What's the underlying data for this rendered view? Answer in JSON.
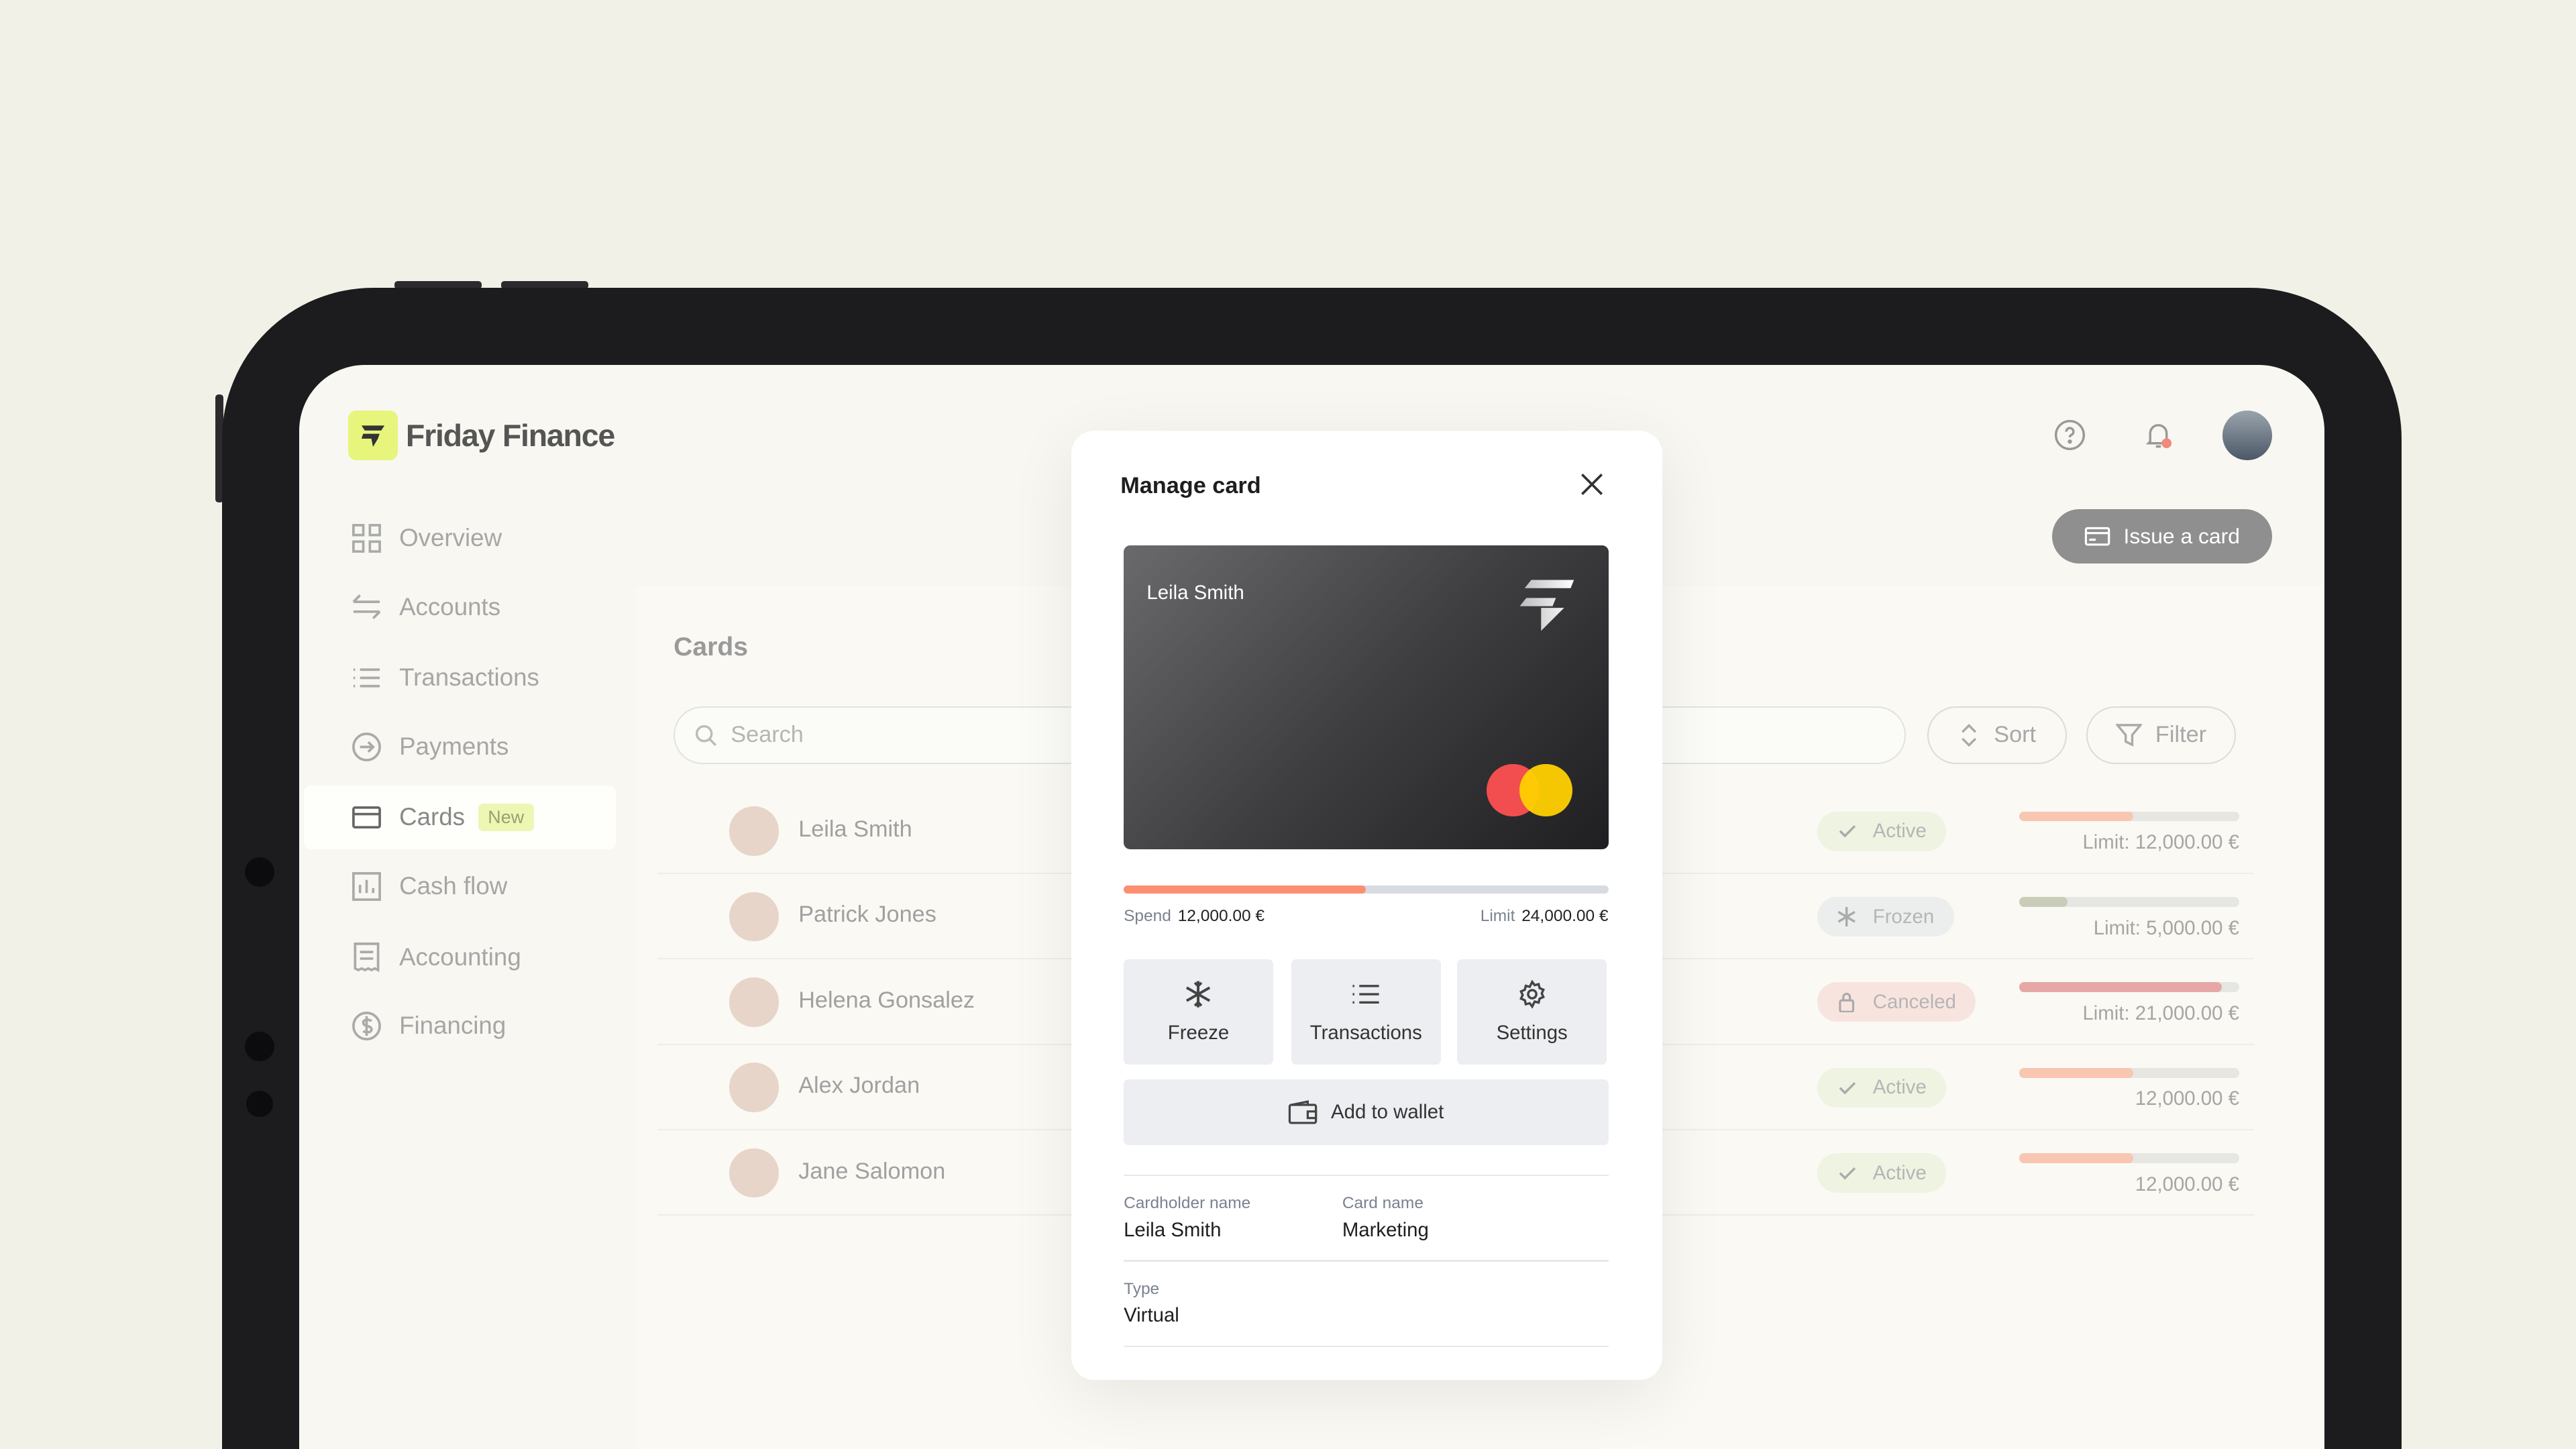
{
  "app": {
    "brand": "Friday Finance"
  },
  "sidebar": {
    "items": [
      {
        "label": "Overview",
        "icon": "grid-icon"
      },
      {
        "label": "Accounts",
        "icon": "arrows-icon"
      },
      {
        "label": "Transactions",
        "icon": "list-icon"
      },
      {
        "label": "Payments",
        "icon": "arrow-circle-icon"
      },
      {
        "label": "Cards",
        "icon": "card-icon",
        "badge": "New",
        "selected": true
      },
      {
        "label": "Cash flow",
        "icon": "chart-icon"
      },
      {
        "label": "Accounting",
        "icon": "receipt-icon"
      },
      {
        "label": "Financing",
        "icon": "dollar-icon"
      }
    ]
  },
  "header": {
    "issue_label": "Issue a card"
  },
  "cards": {
    "title": "Cards",
    "search_placeholder": "Search",
    "sort_label": "Sort",
    "filter_label": "Filter",
    "rows": [
      {
        "name": "Leila Smith",
        "status": "Active",
        "limit": "Limit: 12,000.00 €",
        "spent_fraction": 0.52
      },
      {
        "name": "Patrick Jones",
        "status": "Frozen",
        "limit": "Limit: 5,000.00 €",
        "spent_fraction": 0.22
      },
      {
        "name": "Helena Gonsalez",
        "status": "Canceled",
        "limit": "Limit: 21,000.00 €",
        "spent_fraction": 0.92
      },
      {
        "name": "Alex Jordan",
        "status": "Active",
        "limit": "12,000.00 €",
        "spent_fraction": 0.52
      },
      {
        "name": "Jane Salomon",
        "status": "Active",
        "limit": "12,000.00 €",
        "spent_fraction": 0.52
      }
    ]
  },
  "modal": {
    "title": "Manage card",
    "card_holder": "Leila Smith",
    "spend_label": "Spend",
    "spend_value": "12,000.00 €",
    "limit_label": "Limit",
    "limit_value": "24,000.00 €",
    "spent_fraction": 0.5,
    "actions": {
      "freeze": "Freeze",
      "transactions": "Transactions",
      "settings": "Settings",
      "wallet": "Add to wallet"
    },
    "fields": {
      "cardholder_label": "Cardholder name",
      "cardholder_value": "Leila Smith",
      "cardname_label": "Card name",
      "cardname_value": "Marketing",
      "type_label": "Type",
      "type_value": "Virtual"
    }
  },
  "colors": {
    "brand": "#e7f57c",
    "spend": "#fb8f72",
    "button": "#8f8f8f"
  }
}
